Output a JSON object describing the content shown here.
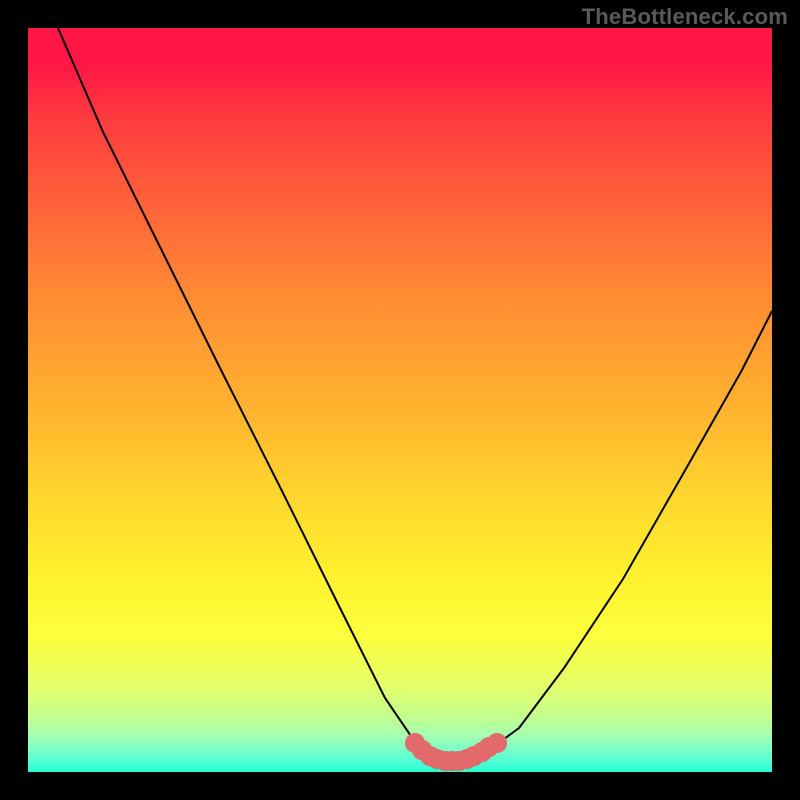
{
  "watermark": "TheBottleneck.com",
  "chart_data": {
    "type": "line",
    "title": "",
    "xlabel": "",
    "ylabel": "",
    "xlim": [
      0,
      100
    ],
    "ylim": [
      0,
      100
    ],
    "series": [
      {
        "name": "bottleneck-curve",
        "x": [
          4,
          10,
          18,
          26,
          34,
          42,
          48,
          52,
          54,
          56,
          58,
          60,
          62,
          66,
          72,
          80,
          88,
          96,
          100
        ],
        "y": [
          100,
          86,
          70,
          54,
          38,
          22,
          10,
          4,
          2,
          1.5,
          1.5,
          2,
          3,
          6,
          14,
          26,
          40,
          54,
          62
        ]
      },
      {
        "name": "optimal-band",
        "x": [
          52,
          53,
          54,
          55,
          56,
          57,
          58,
          59,
          60,
          61,
          62,
          63
        ],
        "y": [
          4,
          3,
          2.2,
          1.8,
          1.6,
          1.6,
          1.6,
          1.8,
          2.2,
          2.8,
          3.4,
          4
        ]
      }
    ],
    "background_gradient": {
      "stops": [
        {
          "offset": 0,
          "color": "#ff1846"
        },
        {
          "offset": 50,
          "color": "#ffb02f"
        },
        {
          "offset": 80,
          "color": "#fbff3d"
        },
        {
          "offset": 100,
          "color": "#22ffcf"
        }
      ]
    },
    "marker_color": "#e26a6a",
    "curve_color": "#000000"
  }
}
